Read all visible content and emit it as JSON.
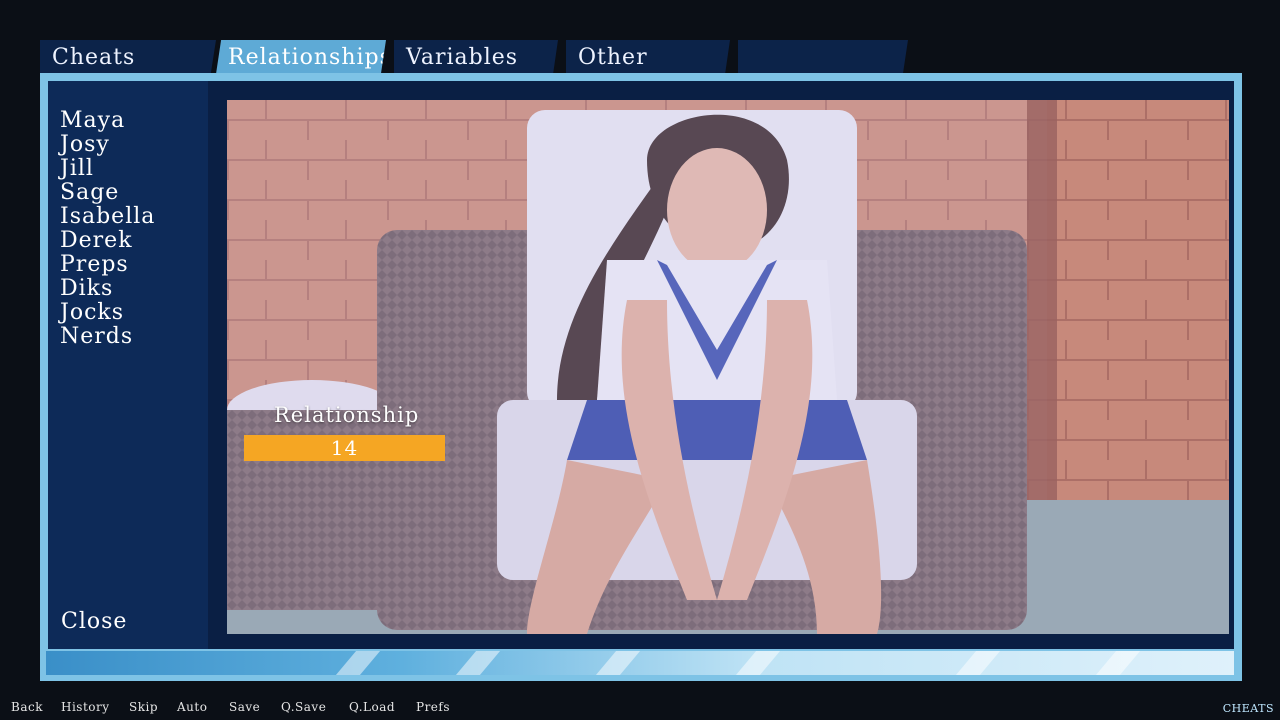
{
  "tabs": [
    {
      "label": "Cheats"
    },
    {
      "label": "Relationships"
    },
    {
      "label": "Variables"
    },
    {
      "label": "Other"
    },
    {
      "label": ""
    }
  ],
  "active_tab": "Relationships",
  "characters": [
    "Maya",
    "Josy",
    "Jill",
    "Sage",
    "Isabella",
    "Derek",
    "Preps",
    "Diks",
    "Jocks",
    "Nerds"
  ],
  "close_label": "Close",
  "relationship": {
    "label": "Relationship",
    "value": "14"
  },
  "quick_menu": [
    "Back",
    "History",
    "Skip",
    "Auto",
    "Save",
    "Q.Save",
    "Q.Load",
    "Prefs"
  ],
  "corner_label": "CHEATS",
  "colors": {
    "accent": "#7ec3e6",
    "panel": "#0a1f44",
    "bar": "#f5a623"
  }
}
